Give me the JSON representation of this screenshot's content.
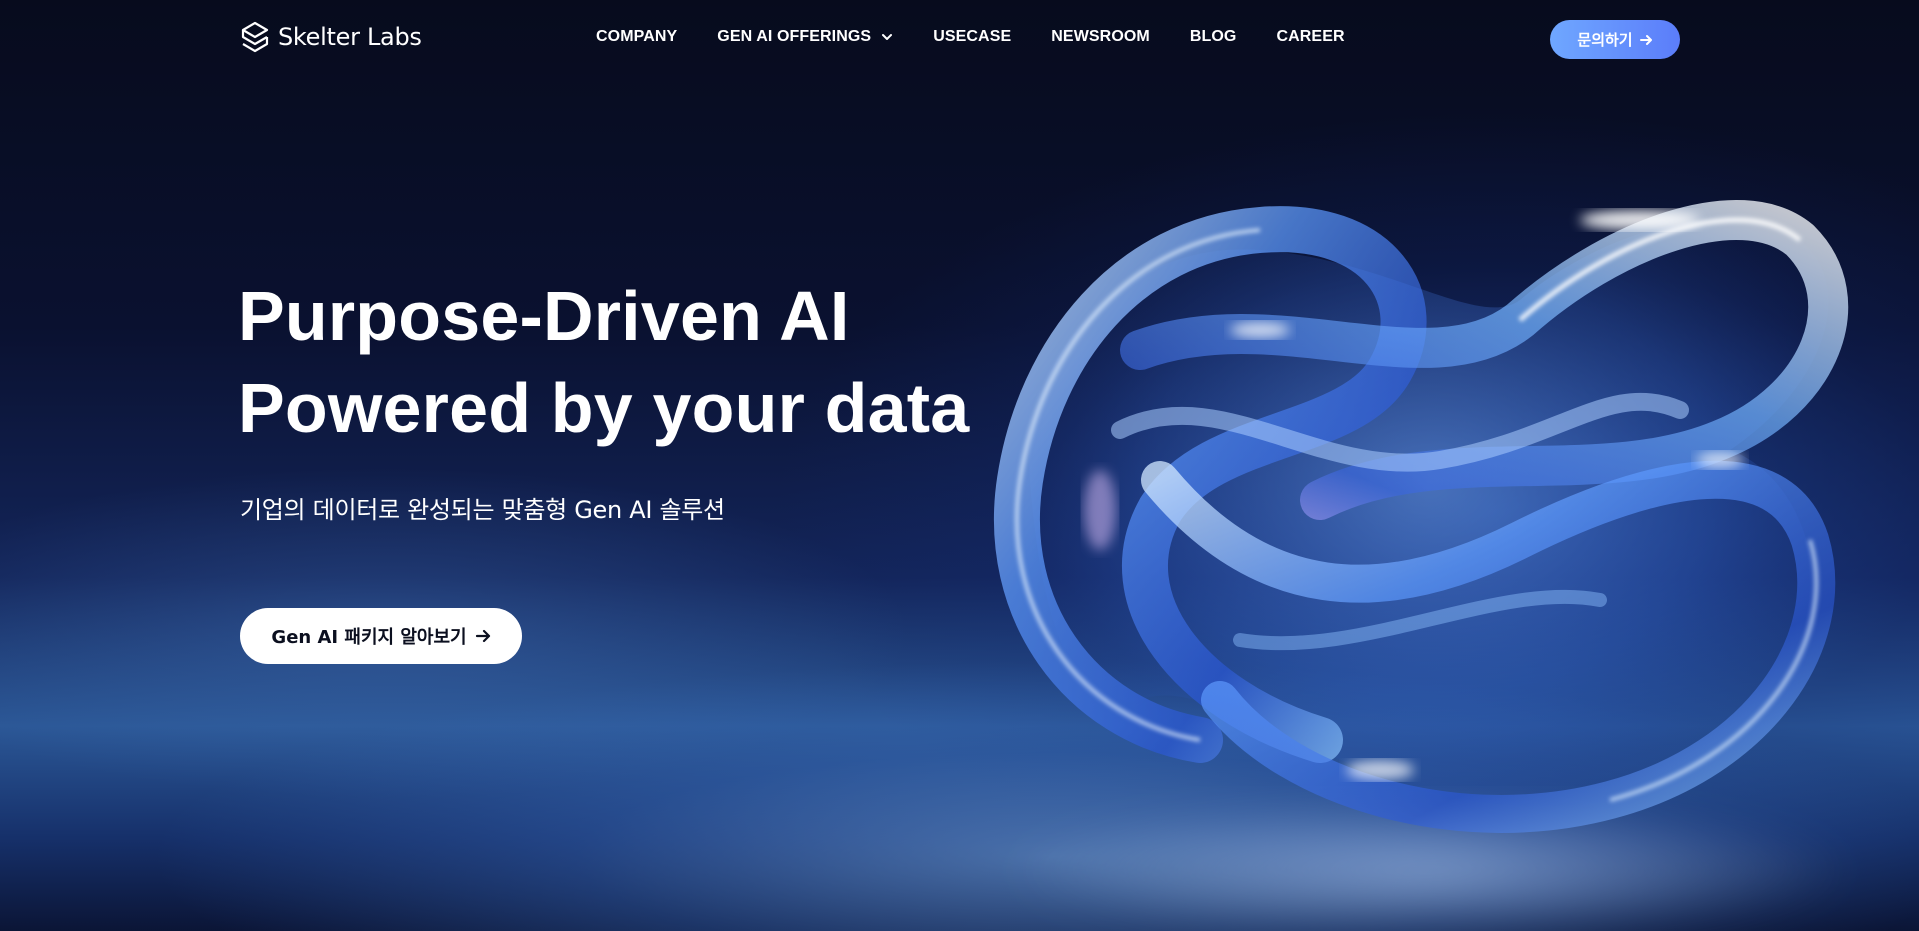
{
  "brand": {
    "name": "Skelter Labs",
    "logo_icon": "skelter-s-icon"
  },
  "nav": {
    "items": [
      {
        "label": "COMPANY"
      },
      {
        "label": "GEN AI OFFERINGS",
        "icon": "chevron-down-icon"
      },
      {
        "label": "USECASE"
      },
      {
        "label": "NEWSROOM"
      },
      {
        "label": "BLOG"
      },
      {
        "label": "CAREER"
      }
    ],
    "contact_label": "문의하기",
    "contact_icon": "arrow-right-icon"
  },
  "hero": {
    "title_line1": "Purpose-Driven AI",
    "title_line2": "Powered by your data",
    "subtitle": "기업의 데이터로 완성되는 맞춤형 Gen AI 솔루션",
    "cta_label": "Gen AI 패키지 알아보기",
    "cta_icon": "arrow-right-icon"
  },
  "colors": {
    "background_top": "#070b1d",
    "background_glow": "#2b5796",
    "contact_gradient_start": "#6fa7ff",
    "contact_gradient_end": "#5b7dfa",
    "cta_background": "#ffffff",
    "text": "#ffffff"
  }
}
